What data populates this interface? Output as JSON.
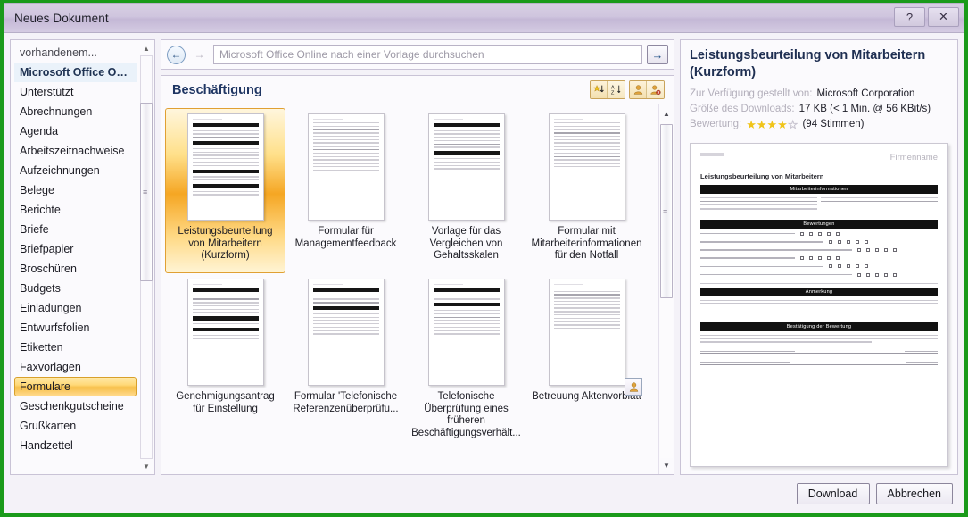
{
  "window": {
    "title": "Neues Dokument",
    "help_label": "?",
    "close_label": "✕"
  },
  "sidebar": {
    "scroll_up": "▲",
    "scroll_down": "▼",
    "items": [
      {
        "label": "vorhandenem...",
        "state": "dim"
      },
      {
        "label": "Microsoft Office Online",
        "state": "bold"
      },
      {
        "label": "Unterstützt",
        "state": "normal"
      },
      {
        "label": "Abrechnungen",
        "state": "normal"
      },
      {
        "label": "Agenda",
        "state": "normal"
      },
      {
        "label": "Arbeitszeitnachweise",
        "state": "normal"
      },
      {
        "label": "Aufzeichnungen",
        "state": "normal"
      },
      {
        "label": "Belege",
        "state": "normal"
      },
      {
        "label": "Berichte",
        "state": "normal"
      },
      {
        "label": "Briefe",
        "state": "normal"
      },
      {
        "label": "Briefpapier",
        "state": "normal"
      },
      {
        "label": "Broschüren",
        "state": "normal"
      },
      {
        "label": "Budgets",
        "state": "normal"
      },
      {
        "label": "Einladungen",
        "state": "normal"
      },
      {
        "label": "Entwurfsfolien",
        "state": "normal"
      },
      {
        "label": "Etiketten",
        "state": "normal"
      },
      {
        "label": "Faxvorlagen",
        "state": "normal"
      },
      {
        "label": "Formulare",
        "state": "selected"
      },
      {
        "label": "Geschenkgutscheine",
        "state": "normal"
      },
      {
        "label": "Grußkarten",
        "state": "normal"
      },
      {
        "label": "Handzettel",
        "state": "normal"
      }
    ]
  },
  "search": {
    "back_icon": "←",
    "forward_icon": "→",
    "placeholder": "Microsoft Office Online nach einer Vorlage durchsuchen",
    "value": "",
    "go_icon": "→"
  },
  "gallery": {
    "heading": "Beschäftigung",
    "toolbar": [
      {
        "name": "sort-by-rating-icon",
        "glyph": "★↓"
      },
      {
        "name": "sort-alphabetical-icon",
        "glyph": "A↓"
      },
      {
        "name": "show-user-templates-icon",
        "glyph": "👤"
      },
      {
        "name": "hide-user-templates-icon",
        "glyph": "👤"
      }
    ],
    "scroll_up": "▲",
    "scroll_down": "▼",
    "templates": [
      {
        "label": "Leistungsbeurteilung von Mitarbeitern (Kurzform)",
        "selected": true,
        "badge": false
      },
      {
        "label": "Formular für Managementfeedback",
        "selected": false,
        "badge": false
      },
      {
        "label": "Vorlage für das Vergleichen von Gehaltsskalen",
        "selected": false,
        "badge": false
      },
      {
        "label": "Formular mit Mitarbeiterinformationen für den Notfall",
        "selected": false,
        "badge": false
      },
      {
        "label": "Genehmigungsantrag für Einstellung",
        "selected": false,
        "badge": false
      },
      {
        "label": "Formular 'Telefonische Referenzenüberprüfu...",
        "selected": false,
        "badge": false
      },
      {
        "label": "Telefonische Überprüfung eines früheren Beschäftigungsverhält...",
        "selected": false,
        "badge": false
      },
      {
        "label": "Betreuung Aktenvorblatt",
        "selected": false,
        "badge": true
      }
    ]
  },
  "preview": {
    "title": "Leistungsbeurteilung von Mitarbeitern (Kurzform)",
    "provider_key": "Zur Verfügung gestellt von:",
    "provider_value": "Microsoft Corporation",
    "size_key": "Größe des Downloads:",
    "size_value": "17 KB (< 1 Min. @ 56 KBit/s)",
    "rating_key": "Bewertung:",
    "rating_stars_filled": 4,
    "rating_stars_empty": 1,
    "rating_votes": "(94 Stimmen)",
    "document": {
      "company_label": "Firmenname",
      "doc_title": "Leistungsbeurteilung von Mitarbeitern",
      "band_employee_info": "Mitarbeiterinformationen",
      "band_ratings": "Bewertungen",
      "band_comment": "Anmerkung",
      "band_confirm": "Bestätigung der Bewertung"
    }
  },
  "footer": {
    "download_label": "Download",
    "cancel_label": "Abbrechen"
  },
  "colors": {
    "accent_orange": "#f5a623",
    "title_blue": "#1f3663",
    "window_border_green": "#1a9a1a",
    "titlebar_purple": "#cfc5de"
  }
}
